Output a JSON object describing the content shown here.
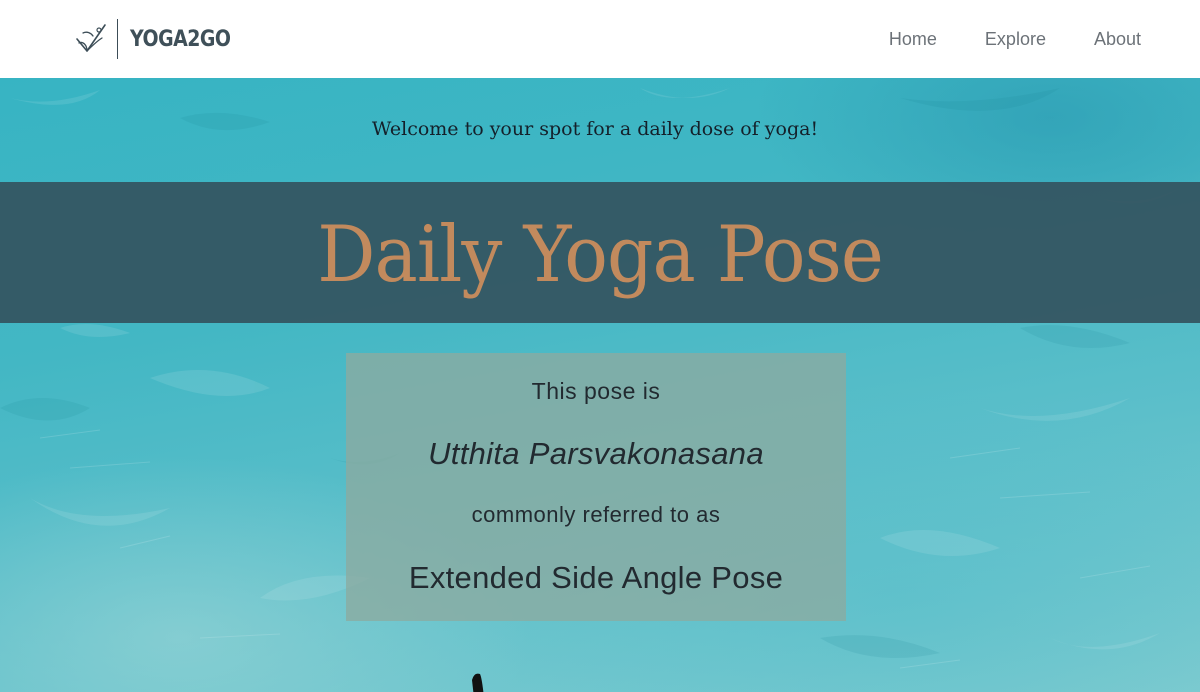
{
  "navbar": {
    "brand_name": "YOGA2GO",
    "links": [
      {
        "label": "Home"
      },
      {
        "label": "Explore"
      },
      {
        "label": "About"
      }
    ]
  },
  "hero": {
    "welcome_text": "Welcome to your spot for a daily dose of yoga!",
    "title": "Daily Yoga Pose"
  },
  "pose": {
    "intro": "This pose is",
    "sanskrit_name": "Utthita Parsvakonasana",
    "common_intro": "commonly referred to as",
    "english_name": "Extended Side Angle Pose"
  },
  "icons": {
    "brand_logo": "yoga-checkmark-logo-icon",
    "pose_figure": "pose-silhouette-icon"
  },
  "colors": {
    "title": "#c28a5d",
    "title_band": "#345460",
    "hero_teal": "#43b7c4",
    "brand_text": "#3f5059",
    "nav_link": "#6c7278"
  }
}
